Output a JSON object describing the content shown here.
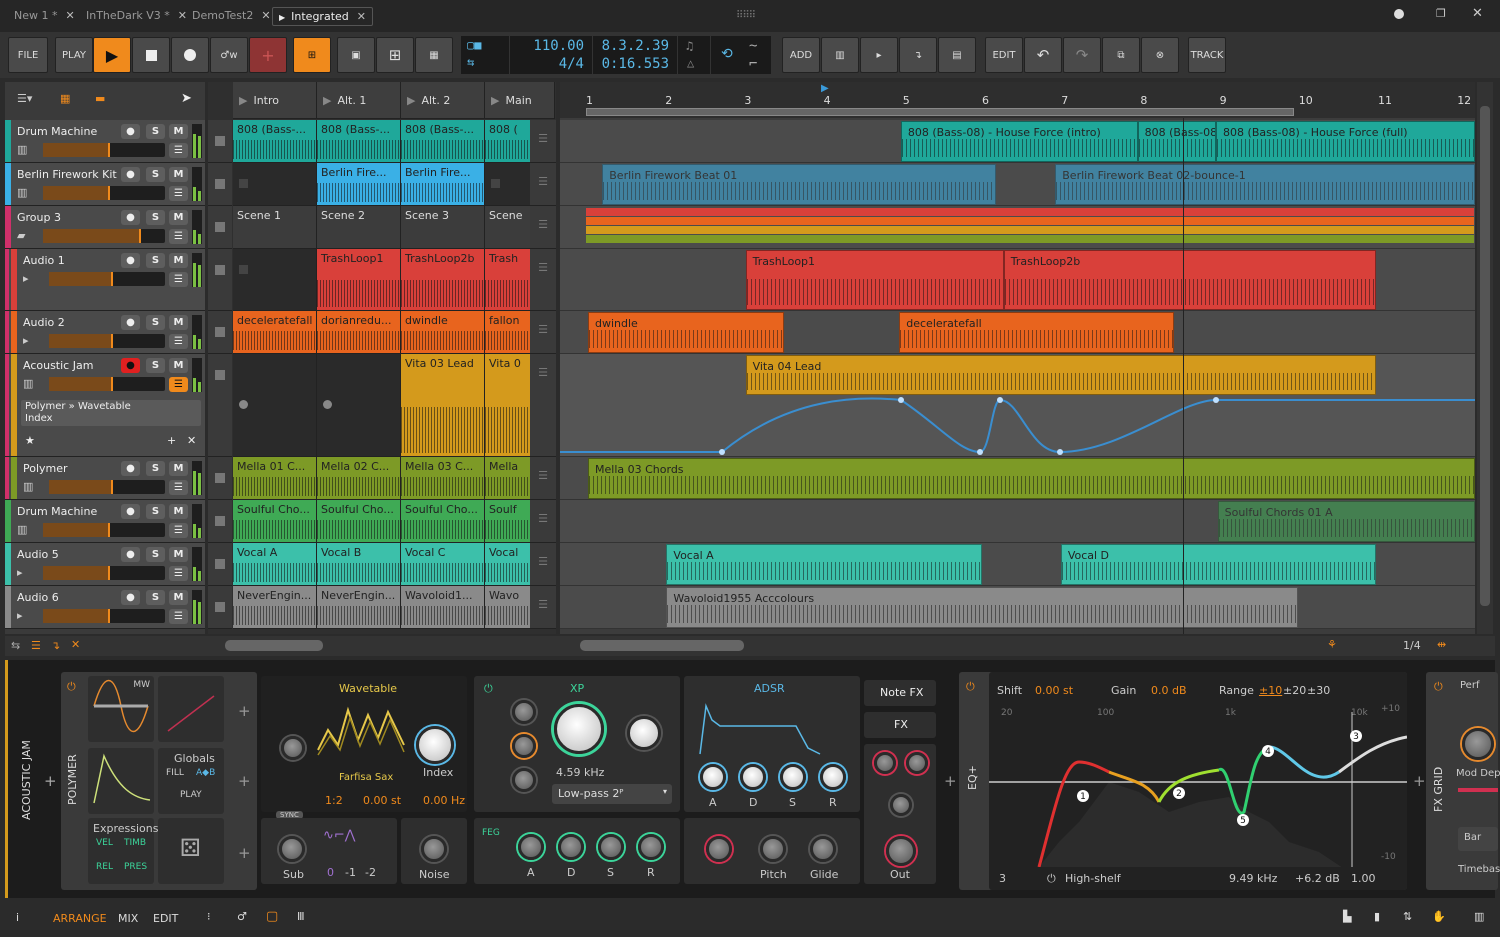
{
  "tabs": [
    {
      "label": "New 1 *"
    },
    {
      "label": "InTheDark V3 *"
    },
    {
      "label": "DemoTest2"
    },
    {
      "label": "Integrated",
      "active": true
    }
  ],
  "toolbar": {
    "file": "FILE",
    "play": "PLAY",
    "add": "ADD",
    "edit": "EDIT",
    "track": "TRACK",
    "tempo": "110.00",
    "signature": "4/4",
    "position": "8.3.2.39",
    "time": "0:16.553"
  },
  "scenes": [
    "Intro",
    "Alt. 1",
    "Alt. 2",
    "Main"
  ],
  "tracks": [
    {
      "name": "Drum Machine",
      "color": "#1fa89a",
      "icon": "drum-icon",
      "cells": [
        "808 (Bass-...",
        "808 (Bass-...",
        "808 (Bass-...",
        "808 ("
      ]
    },
    {
      "name": "Berlin Firework Kit",
      "color": "#3ab0e6",
      "icon": "drum-icon",
      "cells": [
        "",
        "Berlin Fire...",
        "Berlin Fire...",
        ""
      ]
    },
    {
      "name": "Group 3",
      "color": "#d0306a",
      "icon": "folder-icon",
      "cells": [
        "Scene 1",
        "Scene 2",
        "Scene 3",
        "Scene"
      ]
    },
    {
      "name": "Audio 1",
      "color": "#d9403a",
      "icon": "audio-icon",
      "cells": [
        "",
        "TrashLoop1",
        "TrashLoop2b",
        "Trash"
      ]
    },
    {
      "name": "Audio 2",
      "color": "#e8641e",
      "icon": "audio-icon",
      "cells": [
        "deceleratefall",
        "dorianredu...",
        "dwindle",
        "fallon"
      ]
    },
    {
      "name": "Acoustic Jam",
      "color": "#d49a1c",
      "icon": "instrument-icon",
      "armed": true,
      "cells": [
        "",
        "",
        "Vita 03 Lead",
        "Vita 0"
      ]
    },
    {
      "name": "Polymer",
      "color": "#7d9a26",
      "icon": "instrument-icon",
      "cells": [
        "Mella 01 C...",
        "Mella 02 C...",
        "Mella 03 C...",
        "Mella"
      ]
    },
    {
      "name": "Drum Machine",
      "color": "#3faa55",
      "icon": "drum-icon",
      "cells": [
        "Soulful Cho...",
        "Soulful Cho...",
        "Soulful Cho...",
        "Soulf"
      ]
    },
    {
      "name": "Audio 5",
      "color": "#3cc0aa",
      "icon": "audio-icon",
      "cells": [
        "Vocal A",
        "Vocal B",
        "Vocal C",
        "Vocal"
      ]
    },
    {
      "name": "Audio 6",
      "color": "#8a8a8a",
      "icon": "audio-icon",
      "cells": [
        "NeverEngin...",
        "NeverEngin...",
        "Wavoloid1...",
        "Wavo"
      ]
    }
  ],
  "automation_param": {
    "path": "Polymer » Wavetable",
    "param": "Index"
  },
  "ruler": [
    "1",
    "2",
    "3",
    "4",
    "5",
    "6",
    "7",
    "8",
    "9",
    "10",
    "11",
    "12"
  ],
  "arrangement": [
    {
      "track": 0,
      "clips": [
        {
          "name": "808 (Bass-08) - House Force (intro)",
          "start": 4.95,
          "end": 7.94
        },
        {
          "name": "808 (Bass-08)",
          "start": 7.94,
          "end": 8.93
        },
        {
          "name": "808 (Bass-08) - House Force (full)",
          "start": 8.93,
          "end": 12.2
        }
      ]
    },
    {
      "track": 1,
      "faded": true,
      "clips": [
        {
          "name": "Berlin Firework Beat 01",
          "start": 1.18,
          "end": 6.15
        },
        {
          "name": "Berlin Firework Beat 02-bounce-1",
          "start": 6.9,
          "end": 12.2
        }
      ]
    },
    {
      "track": 2,
      "clips": []
    },
    {
      "track": 3,
      "clips": [
        {
          "name": "TrashLoop1",
          "start": 2.99,
          "end": 6.25
        },
        {
          "name": "TrashLoop2b",
          "start": 6.25,
          "end": 10.95
        }
      ]
    },
    {
      "track": 4,
      "clips": [
        {
          "name": "dwindle",
          "start": 1,
          "end": 3.48
        },
        {
          "name": "deceleratefall",
          "start": 4.93,
          "end": 8.4
        }
      ]
    },
    {
      "track": 5,
      "clips": [
        {
          "name": "Vita 04 Lead",
          "start": 2.99,
          "end": 10.95
        }
      ]
    },
    {
      "track": 6,
      "clips": [
        {
          "name": "Mella 03 Chords",
          "start": 1,
          "end": 12.2
        }
      ]
    },
    {
      "track": 7,
      "faded": true,
      "clips": [
        {
          "name": "Soulful Chords 01 A",
          "start": 8.95,
          "end": 12.2
        }
      ]
    },
    {
      "track": 8,
      "clips": [
        {
          "name": "Vocal A",
          "start": 1.99,
          "end": 5.97
        },
        {
          "name": "Vocal D",
          "start": 6.97,
          "end": 10.95
        }
      ]
    },
    {
      "track": 9,
      "clips": [
        {
          "name": "Wavoloid1955 Acccolours",
          "start": 1.99,
          "end": 9.96
        }
      ]
    }
  ],
  "zoom_label": "1/4",
  "device": {
    "track_label": "ACOUSTIC JAM",
    "chain_label": "POLYMER",
    "mod_mw": "MW",
    "globals": "Globals",
    "fill": "FILL",
    "ab": "A◆B",
    "play": "PLAY",
    "expressions": "Expressions",
    "vel": "VEL",
    "timb": "TIMB",
    "rel": "REL",
    "pres": "PRES",
    "osc_type": "Wavetable",
    "wavetable_name": "Farfisa Sax",
    "index_label": "Index",
    "ratio": "1:2",
    "pitch": "0.00 st",
    "fine": "0.00 Hz",
    "sync": "SYNC",
    "sub": "Sub",
    "sub_oct": [
      "0",
      "-1",
      "-2"
    ],
    "noise": "Noise",
    "filter_type": "XP",
    "cutoff": "4.59 kHz",
    "filter_mode": "Low-pass 2ᴾ",
    "feg": "FEG",
    "adsr1": [
      "A",
      "D",
      "S",
      "R"
    ],
    "env_type": "ADSR",
    "adsr2": [
      "A",
      "D",
      "S",
      "R"
    ],
    "note_fx": "Note FX",
    "fx": "FX",
    "pitch_lbl": "Pitch",
    "glide": "Glide",
    "out": "Out",
    "eq_label": "EQ+",
    "shift": "Shift",
    "shift_val": "0.00 st",
    "gain": "Gain",
    "gain_val": "0.0 dB",
    "range": "Range",
    "ranges": [
      "±10",
      "±20",
      "±30"
    ],
    "freq_ticks": [
      "20",
      "100",
      "1k",
      "10k"
    ],
    "db_top": "+10",
    "db_bottom": "-10",
    "band": "3",
    "band_type": "High-shelf",
    "band_freq": "9.49 kHz",
    "band_gain": "+6.2 dB",
    "band_q": "1.00",
    "fxgrid_label": "FX GRID",
    "perf": "Perf",
    "mod_depth": "Mod Dep",
    "bar": "Bar",
    "timebase": "Timebas"
  },
  "status": {
    "arrange": "ARRANGE",
    "mix": "MIX",
    "edit": "EDIT",
    "info": "i"
  },
  "colors": {
    "accent": "#f08a1c",
    "lcd": "#5ab8e6"
  }
}
